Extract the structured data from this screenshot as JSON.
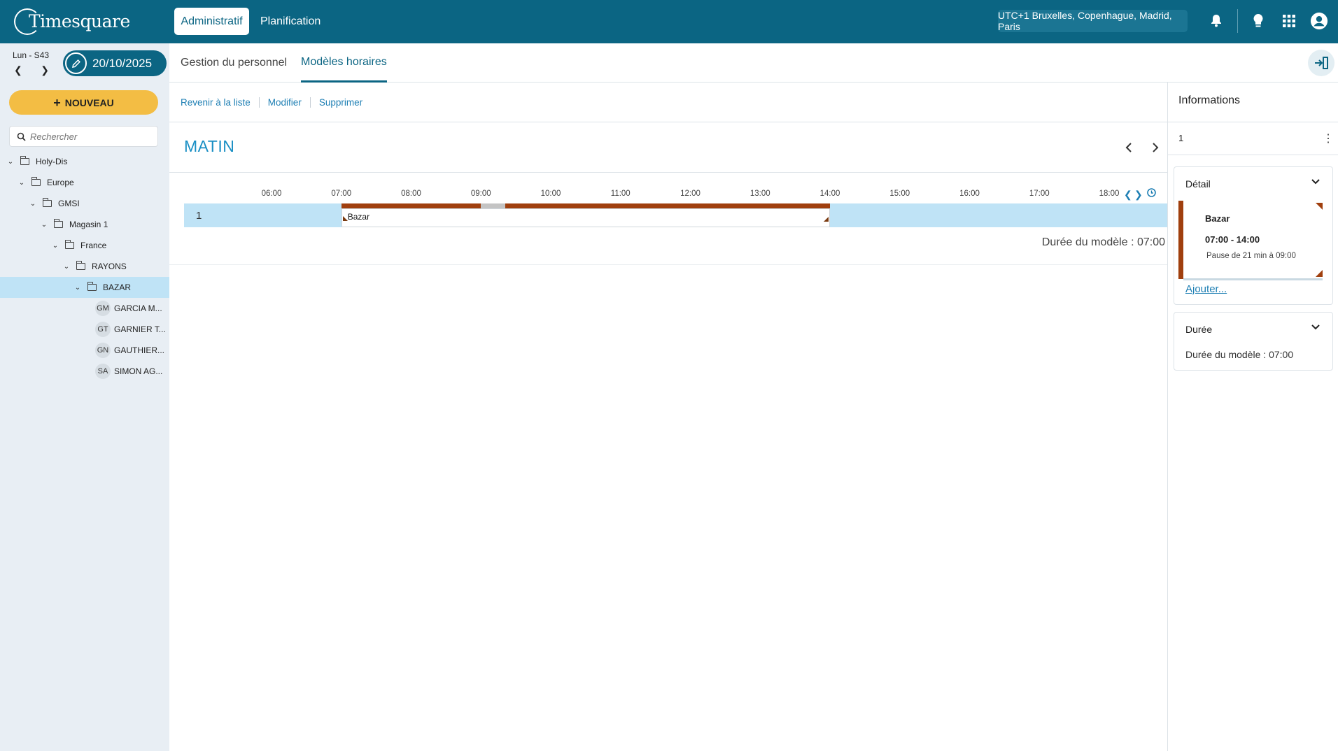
{
  "topbar": {
    "logo_text": "Timesquare",
    "nav": [
      "Administratif",
      "Planification"
    ],
    "timezone": "UTC+1 Bruxelles, Copenhague, Madrid, Paris",
    "icons": [
      "bell-icon",
      "lightbulb-icon",
      "apps-grid-icon",
      "user-account-icon"
    ]
  },
  "date_picker": {
    "week": "Lun - S43",
    "date": "20/10/2025"
  },
  "tabs": [
    "Gestion du personnel",
    "Modèles horaires"
  ],
  "sidebar": {
    "new_label": "NOUVEAU",
    "search_placeholder": "Rechercher",
    "tree": [
      {
        "label": "Holy-Dis",
        "type": "folder",
        "depth": 0
      },
      {
        "label": "Europe",
        "type": "folder",
        "depth": 1
      },
      {
        "label": "GMSI",
        "type": "folder",
        "depth": 2
      },
      {
        "label": "Magasin 1",
        "type": "folder",
        "depth": 3
      },
      {
        "label": "France",
        "type": "folder",
        "depth": 4
      },
      {
        "label": "RAYONS",
        "type": "folder",
        "depth": 5
      },
      {
        "label": "BAZAR",
        "type": "folder",
        "depth": 6,
        "selected": true
      },
      {
        "label": "GARCIA M...",
        "type": "person",
        "initials": "GM",
        "depth": 7
      },
      {
        "label": "GARNIER T...",
        "type": "person",
        "initials": "GT",
        "depth": 7
      },
      {
        "label": "GAUTHIER...",
        "type": "person",
        "initials": "GN",
        "depth": 7
      },
      {
        "label": "SIMON AG...",
        "type": "person",
        "initials": "SA",
        "depth": 7
      }
    ]
  },
  "actions": [
    "Revenir à la liste",
    "Modifier",
    "Supprimer"
  ],
  "model": {
    "title": "MATIN",
    "hours": [
      "06:00",
      "07:00",
      "08:00",
      "09:00",
      "10:00",
      "11:00",
      "12:00",
      "13:00",
      "14:00",
      "15:00",
      "16:00",
      "17:00",
      "18:00"
    ],
    "row_label": "1",
    "segment": {
      "label": "Bazar",
      "start": "07:00",
      "end": "14:00",
      "color": "#a03f0e"
    },
    "pause": {
      "start": "09:00",
      "duration_min": 21
    },
    "duration": "Durée du modèle : 07:00"
  },
  "info_panel": {
    "title": "Informations",
    "row_label": "1",
    "detail": {
      "header": "Détail",
      "name": "Bazar",
      "time": "07:00 - 14:00",
      "pause": "Pause de 21 min à 09:00",
      "add_link": "Ajouter..."
    },
    "duration_card": {
      "header": "Durée",
      "text": "Durée du modèle : 07:00"
    }
  },
  "colors": {
    "topbar": "#0b6583",
    "accent": "#1a8fc4",
    "new_button": "#f3bd44",
    "segment": "#a03f0e",
    "row_highlight": "#bfe3f6"
  }
}
